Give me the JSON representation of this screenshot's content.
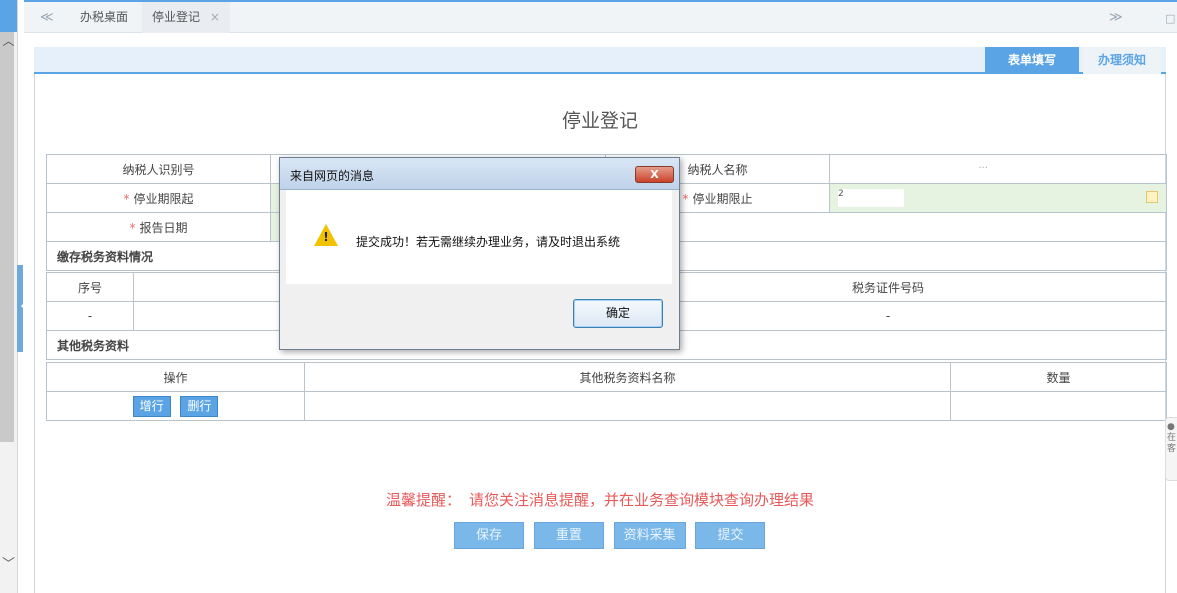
{
  "tabs": {
    "home": "办税桌面",
    "active": "停业登记",
    "close_glyph": "×",
    "prev_glyph": "≪",
    "next_glyph": "≫"
  },
  "header_tabs": {
    "form": "表单填写",
    "notice": "办理须知"
  },
  "page_title": "停业登记",
  "form": {
    "taxpayer_id_label": "纳税人识别号",
    "taxpayer_name_label": "纳税人名称",
    "taxpayer_name_value": "...",
    "start_label": "停业期限起",
    "end_label": "停业期限止",
    "end_value": "2",
    "report_date_label": "报告日期",
    "required_mark": "*"
  },
  "sections": {
    "kept_docs": "缴存税务资料情况",
    "other_docs": "其他税务资料"
  },
  "kept_table": {
    "headers": [
      "序号",
      "税务证件号码"
    ],
    "row": [
      "-",
      "-"
    ]
  },
  "other_table": {
    "headers": [
      "操作",
      "其他税务资料名称",
      "数量"
    ],
    "add_row": "增行",
    "delete_row": "删行"
  },
  "reminder": {
    "label": "温馨提醒：",
    "text": "请您关注消息提醒，并在业务查询模块查询办理结果"
  },
  "actions": [
    "保存",
    "重置",
    "资料采集",
    "提交"
  ],
  "float_tab": [
    "在",
    "客"
  ],
  "dialog": {
    "title": "来自网页的消息",
    "close": "X",
    "message": "提交成功！若无需继续办理业务，请及时退出系统",
    "ok": "确定",
    "warn_mark": "!"
  },
  "colors": {
    "accent": "#5aa4e6",
    "required": "#ef6b6b",
    "reminder": "#e85a5a",
    "readonly_field": "#e6f3e0"
  }
}
